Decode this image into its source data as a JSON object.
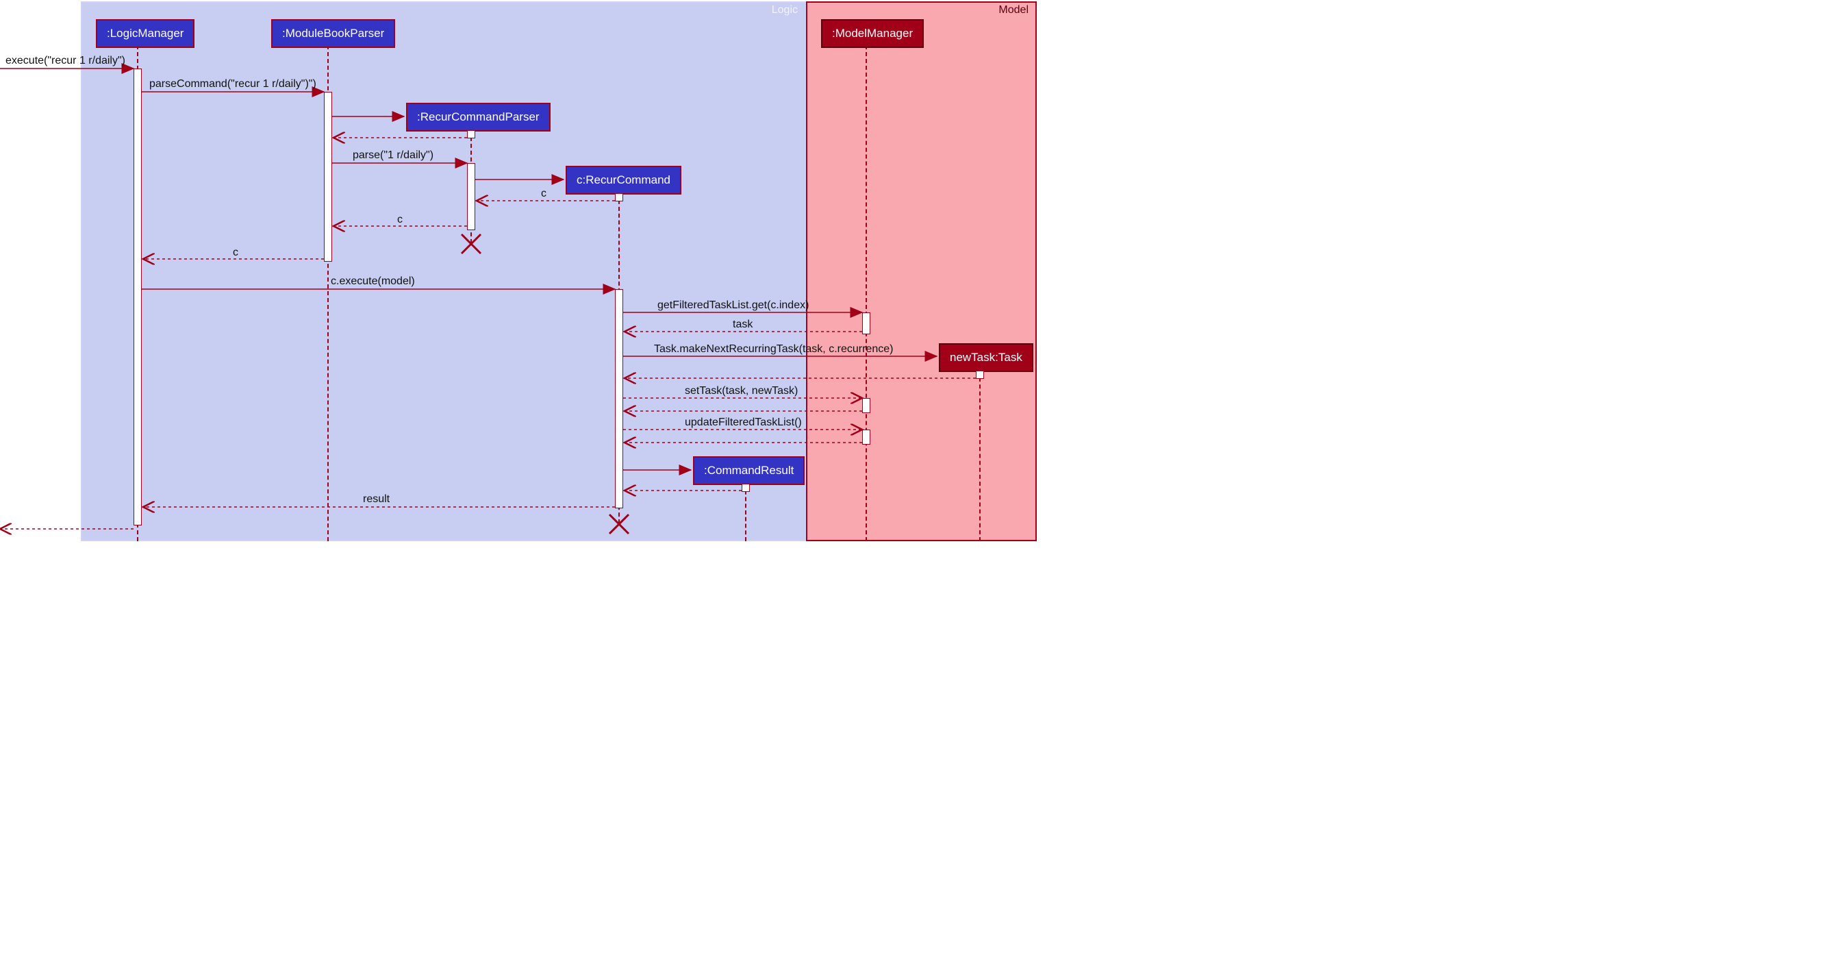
{
  "frames": {
    "logic": "Logic",
    "model": "Model"
  },
  "participants": {
    "logicManager": ":LogicManager",
    "moduleBookParser": ":ModuleBookParser",
    "recurCommandParser": ":RecurCommandParser",
    "recurCommand": "c:RecurCommand",
    "commandResult": ":CommandResult",
    "modelManager": ":ModelManager",
    "newTask": "newTask:Task"
  },
  "messages": {
    "execute": "execute(\"recur 1 r/daily\")",
    "parseCommand": "parseCommand(\"recur 1 r/daily\")\")",
    "parse": "parse(\"1 r/daily\")",
    "returnCParser": "c",
    "returnCParser2": "c",
    "returnC": "c",
    "cExecute": "c.execute(model)",
    "getFilteredTaskList": "getFilteredTaskList.get(c.index)",
    "task": "task",
    "makeNext": "Task.makeNextRecurringTask(task, c.recurrence)",
    "setTask": "setTask(task, newTask)",
    "updateFilteredTaskList": "updateFilteredTaskList()",
    "result": "result"
  },
  "chart_data": {
    "type": "sequence_diagram",
    "frames": [
      {
        "name": "Logic",
        "participants": [
          ":LogicManager",
          ":ModuleBookParser",
          ":RecurCommandParser",
          "c:RecurCommand",
          ":CommandResult"
        ]
      },
      {
        "name": "Model",
        "participants": [
          ":ModelManager",
          "newTask:Task"
        ]
      }
    ],
    "messages": [
      {
        "from": "external",
        "to": ":LogicManager",
        "label": "execute(\"recur 1 r/daily\")",
        "type": "sync"
      },
      {
        "from": ":LogicManager",
        "to": ":ModuleBookParser",
        "label": "parseCommand(\"recur 1 r/daily\")\")",
        "type": "sync"
      },
      {
        "from": ":ModuleBookParser",
        "to": ":RecurCommandParser",
        "label": "",
        "type": "create"
      },
      {
        "from": ":RecurCommandParser",
        "to": ":ModuleBookParser",
        "label": "",
        "type": "return"
      },
      {
        "from": ":ModuleBookParser",
        "to": ":RecurCommandParser",
        "label": "parse(\"1 r/daily\")",
        "type": "sync"
      },
      {
        "from": ":RecurCommandParser",
        "to": "c:RecurCommand",
        "label": "",
        "type": "create"
      },
      {
        "from": "c:RecurCommand",
        "to": ":RecurCommandParser",
        "label": "c",
        "type": "return"
      },
      {
        "from": ":RecurCommandParser",
        "to": ":ModuleBookParser",
        "label": "c",
        "type": "return"
      },
      {
        "from": ":RecurCommandParser",
        "to": "",
        "label": "",
        "type": "destroy"
      },
      {
        "from": ":ModuleBookParser",
        "to": ":LogicManager",
        "label": "c",
        "type": "return"
      },
      {
        "from": ":LogicManager",
        "to": "c:RecurCommand",
        "label": "c.execute(model)",
        "type": "sync"
      },
      {
        "from": "c:RecurCommand",
        "to": ":ModelManager",
        "label": "getFilteredTaskList.get(c.index)",
        "type": "sync"
      },
      {
        "from": ":ModelManager",
        "to": "c:RecurCommand",
        "label": "task",
        "type": "return"
      },
      {
        "from": "c:RecurCommand",
        "to": "newTask:Task",
        "label": "Task.makeNextRecurringTask(task, c.recurrence)",
        "type": "create"
      },
      {
        "from": "newTask:Task",
        "to": "c:RecurCommand",
        "label": "",
        "type": "return"
      },
      {
        "from": "c:RecurCommand",
        "to": ":ModelManager",
        "label": "setTask(task, newTask)",
        "type": "sync"
      },
      {
        "from": ":ModelManager",
        "to": "c:RecurCommand",
        "label": "",
        "type": "return"
      },
      {
        "from": "c:RecurCommand",
        "to": ":ModelManager",
        "label": "updateFilteredTaskList()",
        "type": "sync"
      },
      {
        "from": ":ModelManager",
        "to": "c:RecurCommand",
        "label": "",
        "type": "return"
      },
      {
        "from": "c:RecurCommand",
        "to": ":CommandResult",
        "label": "",
        "type": "create"
      },
      {
        "from": ":CommandResult",
        "to": "c:RecurCommand",
        "label": "",
        "type": "return"
      },
      {
        "from": "c:RecurCommand",
        "to": ":LogicManager",
        "label": "result",
        "type": "return"
      },
      {
        "from": "c:RecurCommand",
        "to": "",
        "label": "",
        "type": "destroy"
      },
      {
        "from": ":LogicManager",
        "to": "external",
        "label": "",
        "type": "return"
      }
    ]
  }
}
